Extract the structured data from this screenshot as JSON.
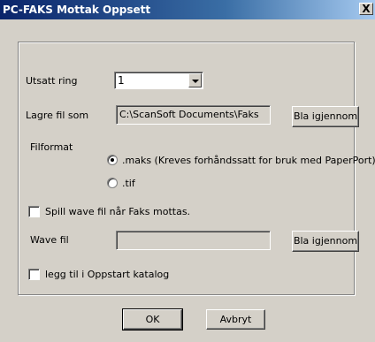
{
  "window": {
    "title": "PC-FAKS Mottak Oppsett",
    "close_glyph": "X"
  },
  "delay_ring": {
    "label": "Utsatt ring",
    "value": "1"
  },
  "save_file": {
    "label": "Lagre fil som",
    "path": "C:\\ScanSoft Documents\\Faks Mott",
    "browse_label": "Bla igjennom"
  },
  "file_format": {
    "label": "Filformat",
    "options": [
      {
        "label": ".maks (Kreves forhåndssatt for bruk med PaperPort)",
        "selected": true
      },
      {
        "label": ".tif",
        "selected": false
      }
    ]
  },
  "play_wave": {
    "label": "Spill wave fil når Faks mottas.",
    "checked": false
  },
  "wave_file": {
    "label": "Wave fil",
    "value": "",
    "browse_label": "Bla igjennom"
  },
  "startup": {
    "label": "legg til i Oppstart katalog",
    "checked": false
  },
  "buttons": {
    "ok": "OK",
    "cancel": "Avbryt"
  }
}
